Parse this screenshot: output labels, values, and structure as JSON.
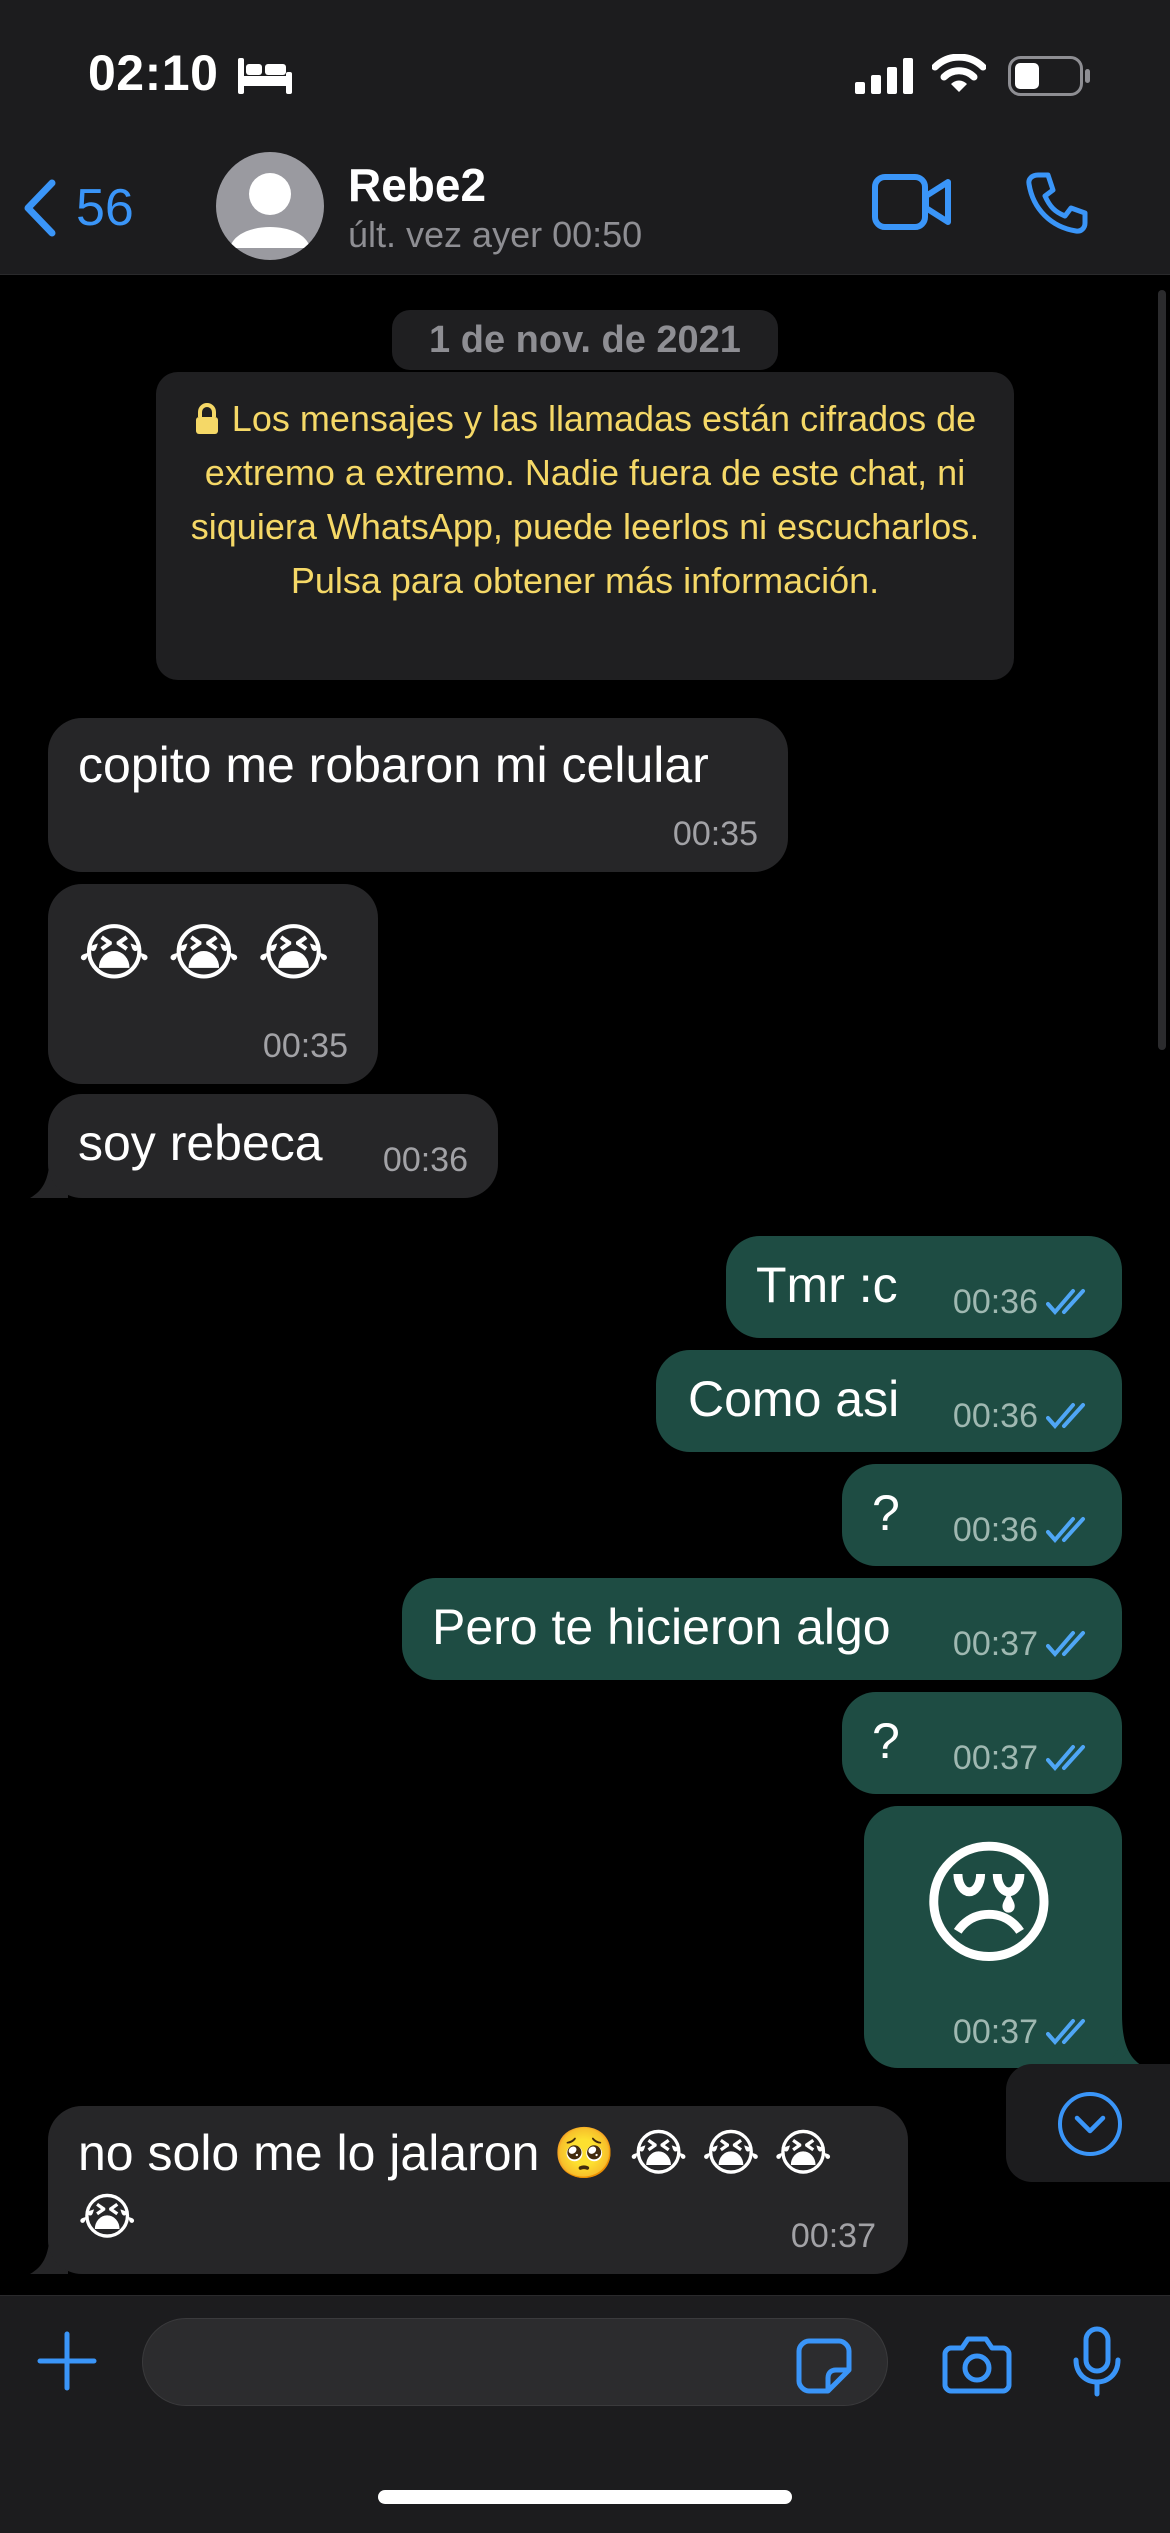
{
  "status_bar": {
    "time": "02:10",
    "icons": [
      "bed-icon",
      "signal-icon",
      "wifi-icon",
      "battery-icon"
    ]
  },
  "header": {
    "back_count": "56",
    "contact_name": "Rebe2",
    "last_seen": "últ. vez ayer 00:50",
    "icons": [
      "chevron-left-icon",
      "avatar",
      "video-call-icon",
      "voice-call-icon"
    ]
  },
  "date_pill": "1 de nov. de 2021",
  "encryption_notice": "Los mensajes y las llamadas están cifrados de extremo a extremo. Nadie fuera de este chat, ni siquiera WhatsApp, puede leerlos ni escucharlos. Pulsa para obtener más información.",
  "messages": [
    {
      "direction": "incoming",
      "text": "copito me robaron mi celular",
      "time": "00:35"
    },
    {
      "direction": "incoming",
      "text": "😭 😭 😭",
      "time": "00:35"
    },
    {
      "direction": "incoming",
      "text": "soy rebeca",
      "time": "00:36"
    },
    {
      "direction": "outgoing",
      "text": "Tmr :c",
      "time": "00:36",
      "status": "read"
    },
    {
      "direction": "outgoing",
      "text": "Como asi",
      "time": "00:36",
      "status": "read"
    },
    {
      "direction": "outgoing",
      "text": "?",
      "time": "00:36",
      "status": "read"
    },
    {
      "direction": "outgoing",
      "text": "Pero te hicieron algo",
      "time": "00:37",
      "status": "read"
    },
    {
      "direction": "outgoing",
      "text": "?",
      "time": "00:37",
      "status": "read"
    },
    {
      "direction": "outgoing",
      "text": "😢",
      "time": "00:37",
      "status": "read"
    },
    {
      "direction": "incoming",
      "text_line1": "no solo me lo jalaron 🥺 😭 😭 😭",
      "text_line2": "😭",
      "time": "00:37"
    }
  ],
  "composer": {
    "placeholder": "",
    "icons": [
      "plus-icon",
      "sticker-icon",
      "camera-icon",
      "microphone-icon"
    ]
  },
  "colors": {
    "accent": "#3a95f8",
    "incoming_bubble": "#262628",
    "outgoing_bubble": "#1e4c43",
    "notice_text": "#f5d867",
    "read_ticks": "#4fa6f5"
  }
}
